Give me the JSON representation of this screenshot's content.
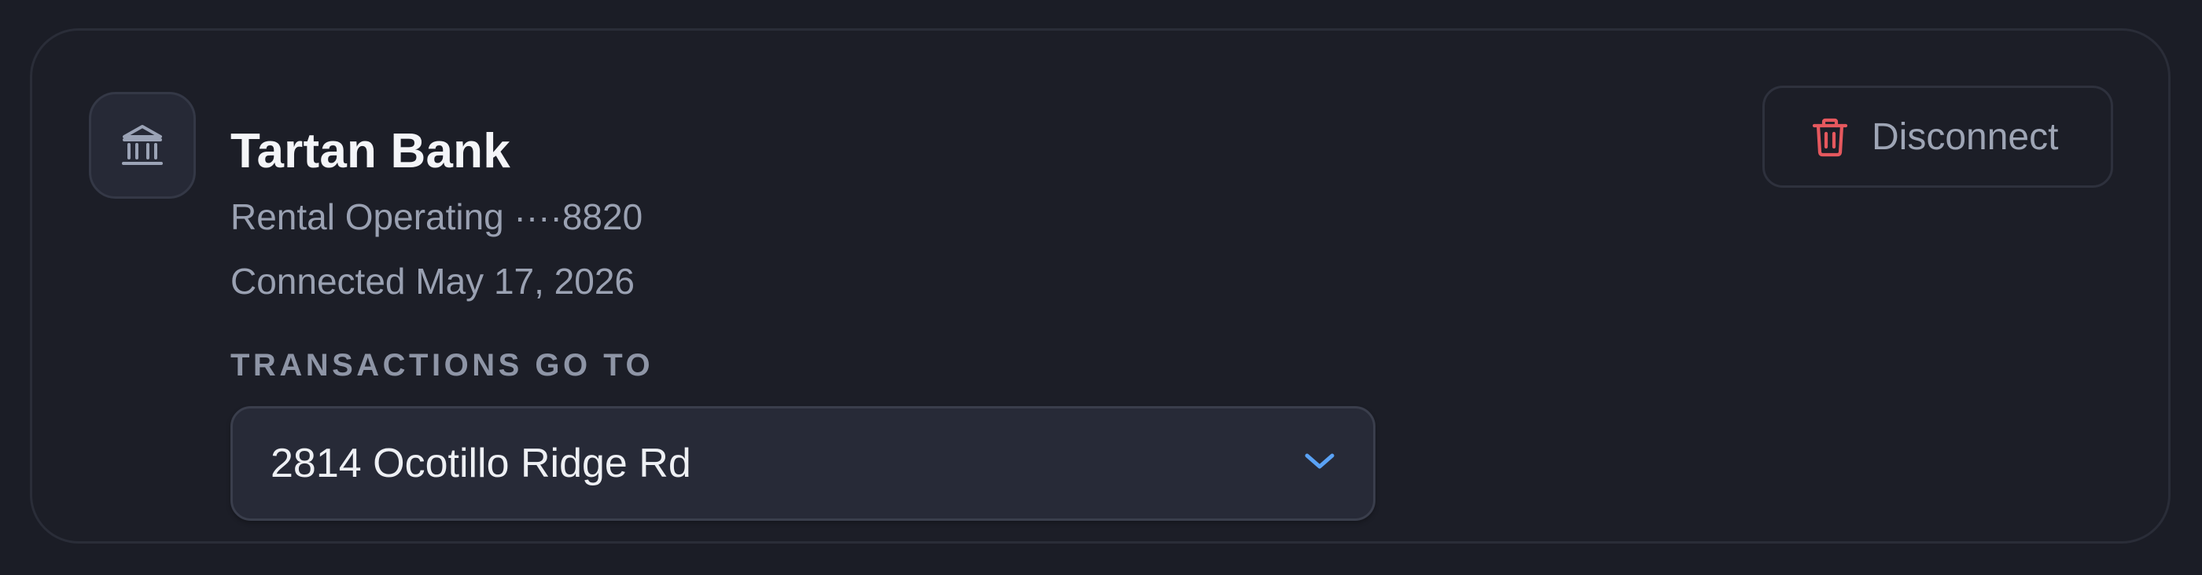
{
  "bank": {
    "name": "Tartan Bank",
    "account": "Rental Operating ····8820",
    "connected": "Connected May 17, 2026",
    "icon": "bank-icon"
  },
  "routing": {
    "label": "TRANSACTIONS GO TO",
    "selected": "2814 Ocotillo Ridge Rd"
  },
  "actions": {
    "disconnect_label": "Disconnect",
    "disconnect_icon": "trash-icon"
  },
  "colors": {
    "accent": "#5aa2f5",
    "danger": "#e5585e"
  }
}
